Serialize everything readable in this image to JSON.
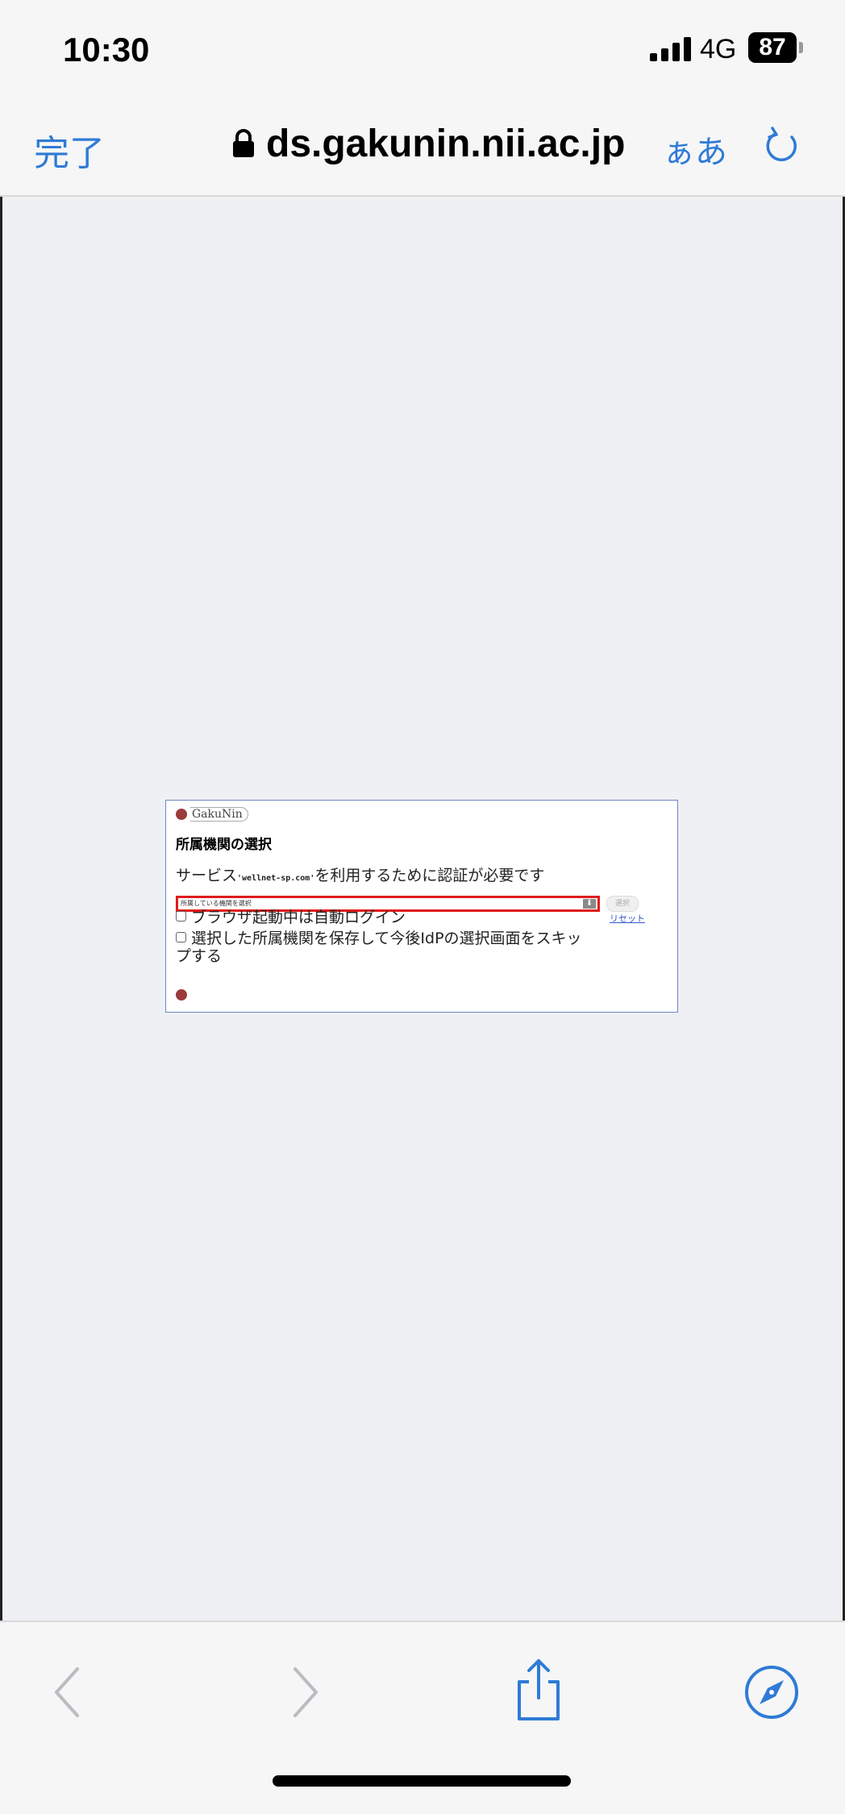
{
  "status_bar": {
    "time": "10:30",
    "network": "4G",
    "battery": "87",
    "signal_icon": "signal-bars-icon"
  },
  "nav_bar": {
    "done_label": "完了",
    "url": "ds.gakunin.nii.ac.jp",
    "text_size_label": "ぁあ",
    "lock_icon": "lock-icon",
    "reload_icon": "reload-icon"
  },
  "panel": {
    "logo_text": "GakuNin",
    "title": "所属機関の選択",
    "service_prefix": "サービス",
    "service_name": "'wellnet-sp.com'",
    "service_suffix": "を利用するために認証が必要です",
    "select_placeholder": "所属している機関を選択",
    "select_button": "選択",
    "reset_link": "リセット",
    "checkbox_auto_login": "ブラウザ起動中は自動ログイン",
    "checkbox_save_idp": "選択した所属機関を保存して今後IdPの選択画面をスキップする"
  },
  "toolbar": {
    "icons": [
      "back-icon",
      "forward-icon",
      "share-icon",
      "bookmarks-compass-icon"
    ]
  },
  "colors": {
    "accent": "#2f7bd6",
    "highlight_border": "#e01b1b",
    "content_bg": "#eef0f3"
  }
}
